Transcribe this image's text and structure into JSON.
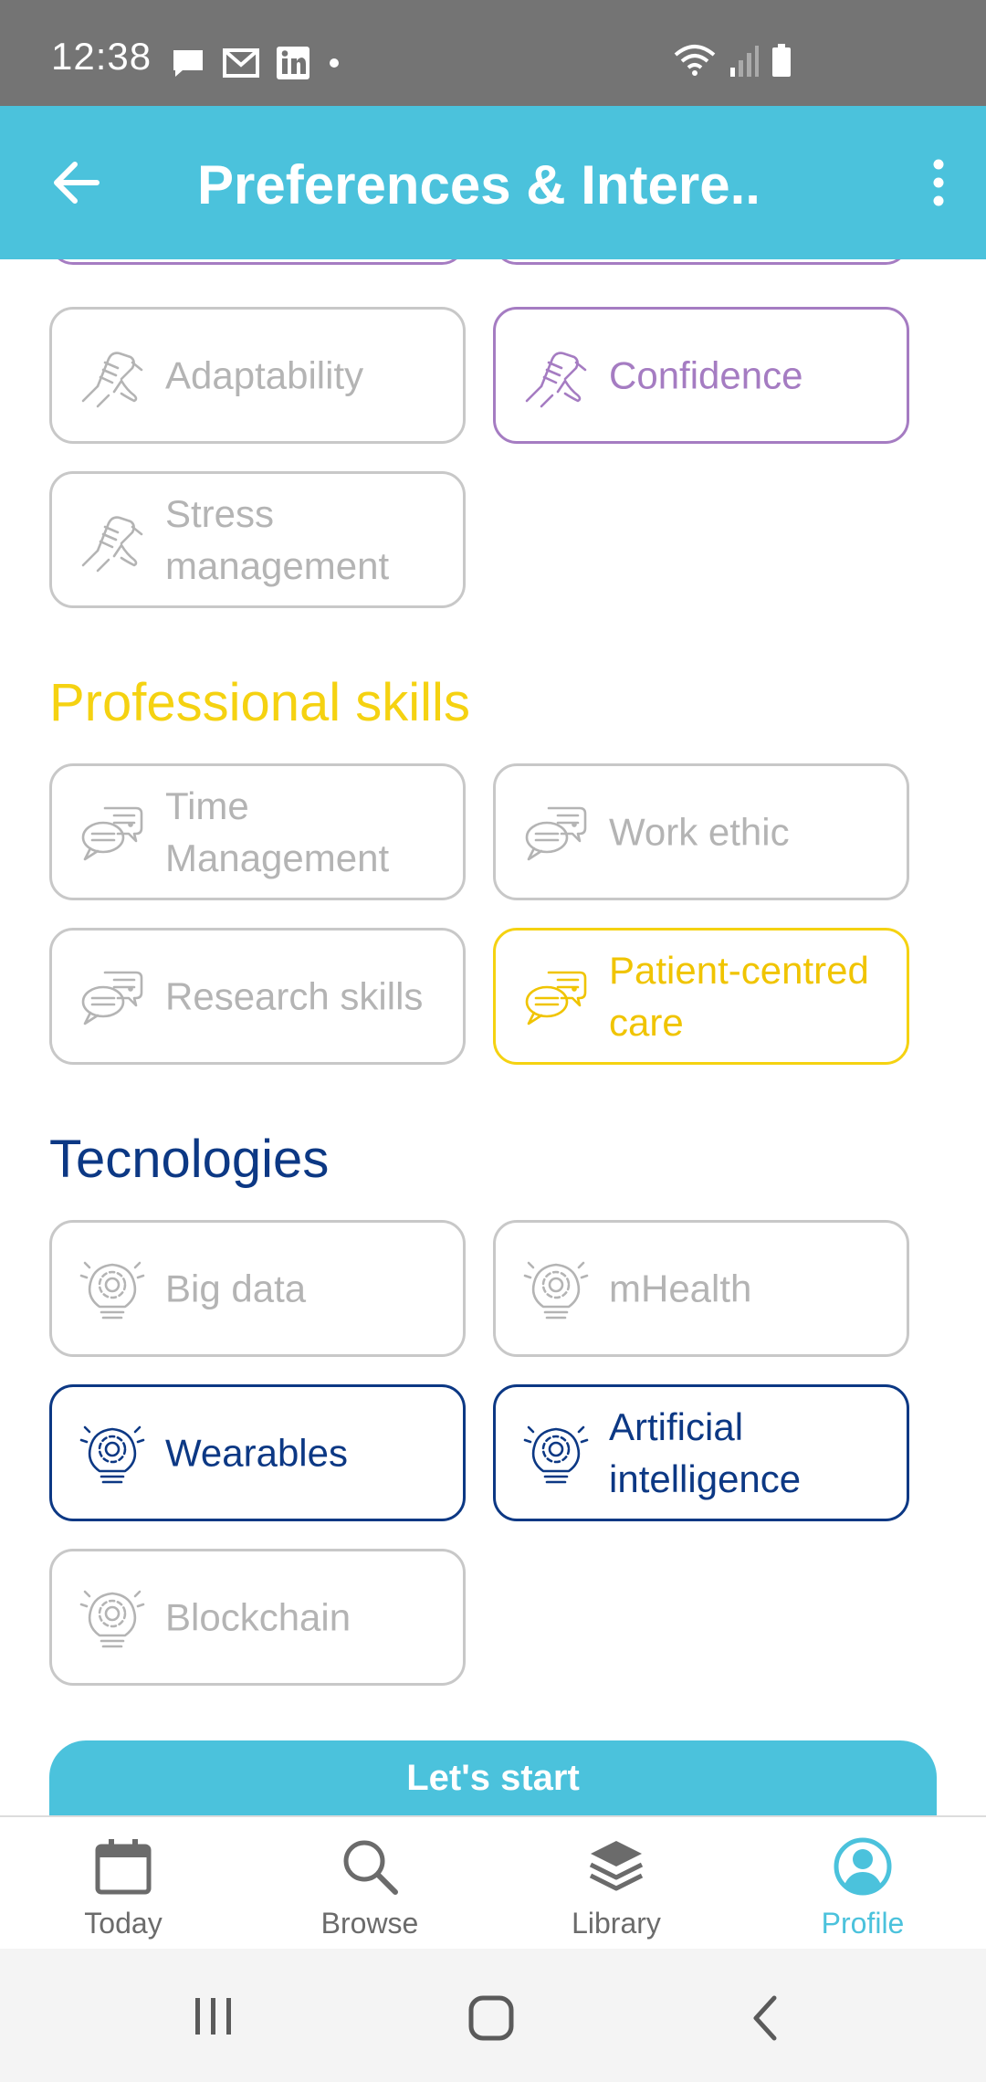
{
  "status_bar": {
    "time": "12:38"
  },
  "app_bar": {
    "title": "Preferences & Intere.."
  },
  "soft_skills": {
    "items": [
      {
        "label": "Adaptability",
        "selected": false
      },
      {
        "label": "Confidence",
        "selected": true
      },
      {
        "label": "Stress management",
        "selected": false
      }
    ],
    "accent": "#a57cc2"
  },
  "professional_skills": {
    "heading": "Professional skills",
    "accent": "#f5d211",
    "items": [
      {
        "label": "Time Management",
        "selected": false
      },
      {
        "label": "Work ethic",
        "selected": false
      },
      {
        "label": "Research skills",
        "selected": false
      },
      {
        "label": "Patient-centred care",
        "selected": true
      }
    ]
  },
  "technologies": {
    "heading": "Tecnologies",
    "accent": "#0c3884",
    "items": [
      {
        "label": "Big data",
        "selected": false
      },
      {
        "label": "mHealth",
        "selected": false
      },
      {
        "label": "Wearables",
        "selected": true
      },
      {
        "label": "Artificial intelligence",
        "selected": true
      },
      {
        "label": "Blockchain",
        "selected": false
      }
    ]
  },
  "cta": {
    "label": "Let's start"
  },
  "bottom_nav": {
    "items": [
      {
        "label": "Today",
        "icon": "calendar-icon",
        "active": false
      },
      {
        "label": "Browse",
        "icon": "search-icon",
        "active": false
      },
      {
        "label": "Library",
        "icon": "layers-icon",
        "active": false
      },
      {
        "label": "Profile",
        "icon": "profile-icon",
        "active": true
      }
    ],
    "active_color": "#4bc2dc"
  },
  "colors": {
    "primary": "#4bc2dc",
    "unselected": "#c8c8c8"
  }
}
